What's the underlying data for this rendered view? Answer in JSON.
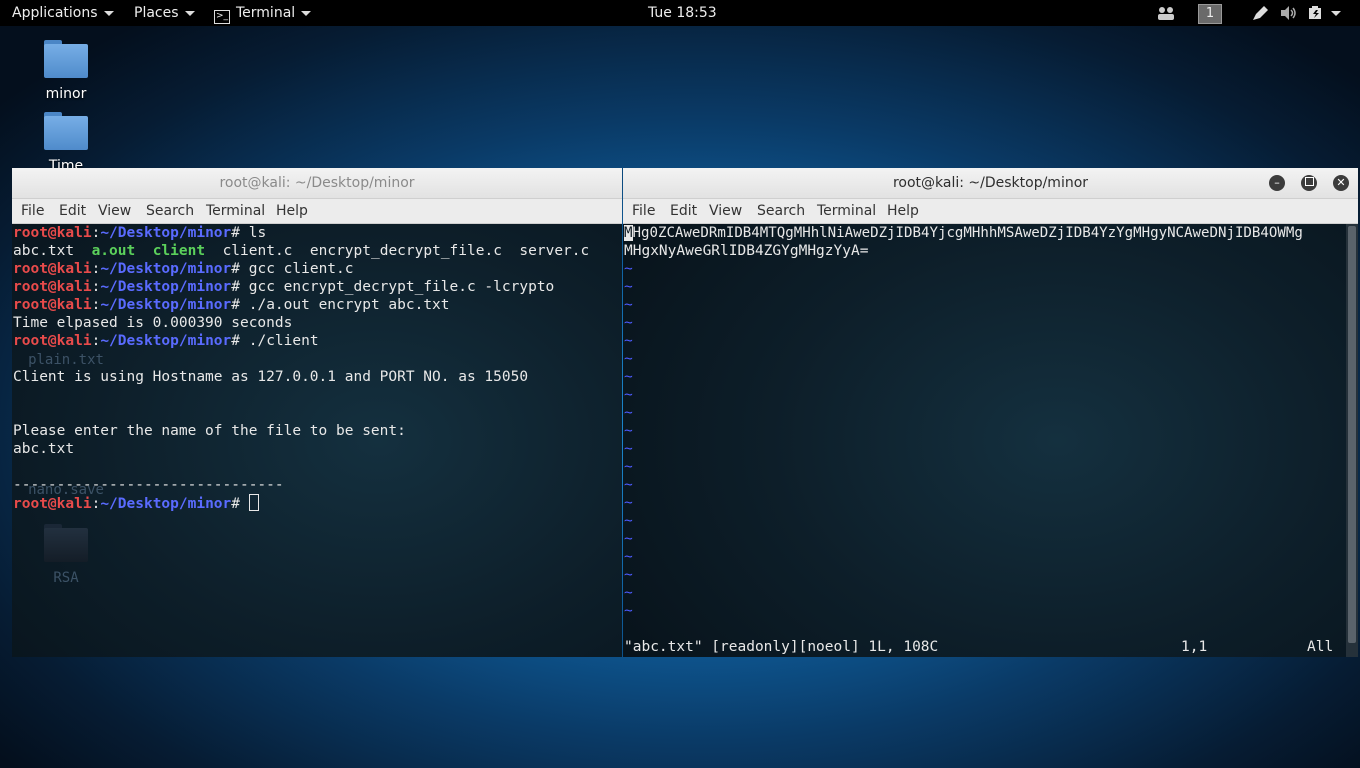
{
  "topbar": {
    "applications": "Applications",
    "places": "Places",
    "terminal": "Terminal",
    "clock": "Tue 18:53",
    "workspace": "1"
  },
  "desktop": {
    "icons": [
      {
        "label": "minor"
      },
      {
        "label": "Time"
      },
      {
        "label": "plain.txt"
      },
      {
        "label": "nano.save"
      },
      {
        "label": "RSA"
      }
    ]
  },
  "left_terminal": {
    "title": "root@kali: ~/Desktop/minor",
    "menu": [
      "File",
      "Edit",
      "View",
      "Search",
      "Terminal",
      "Help"
    ],
    "prompt_user": "root@kali",
    "prompt_path": "~/Desktop/minor",
    "cmd_ls": "ls",
    "ls_out": {
      "f1": "abc.txt",
      "f2": "a.out",
      "f3": "client",
      "f4": "client.c",
      "f5": "encrypt_decrypt_file.c",
      "f6": "server.c"
    },
    "cmd_gcc1": "gcc client.c",
    "cmd_gcc2": "gcc encrypt_decrypt_file.c -lcrypto",
    "cmd_run": "./a.out encrypt abc.txt",
    "out_time": "Time elpased is 0.000390 seconds",
    "cmd_client": "./client",
    "out_host": "Client is using Hostname as 127.0.0.1 and PORT NO. as 15050",
    "out_prompt": "Please enter the name of the file to be sent:",
    "out_file": "abc.txt",
    "out_dashes": "-------------------------------"
  },
  "right_terminal": {
    "title": "root@kali: ~/Desktop/minor",
    "menu": [
      "File",
      "Edit",
      "View",
      "Search",
      "Terminal",
      "Help"
    ],
    "line1_cursor": "M",
    "line1_rest": "Hg0ZCAweDRmIDB4MTQgMHhlNiAweDZjIDB4YjcgMHhhMSAweDZjIDB4YzYgMHgyNCAweDNjIDB4OWMg",
    "line2": "MHgxNyAweGRlIDB4ZGYgMHgzYyA=",
    "tilde": "~",
    "status_file": "\"abc.txt\" [readonly][noeol] 1L, 108C",
    "status_pos": "1,1",
    "status_all": "All"
  }
}
